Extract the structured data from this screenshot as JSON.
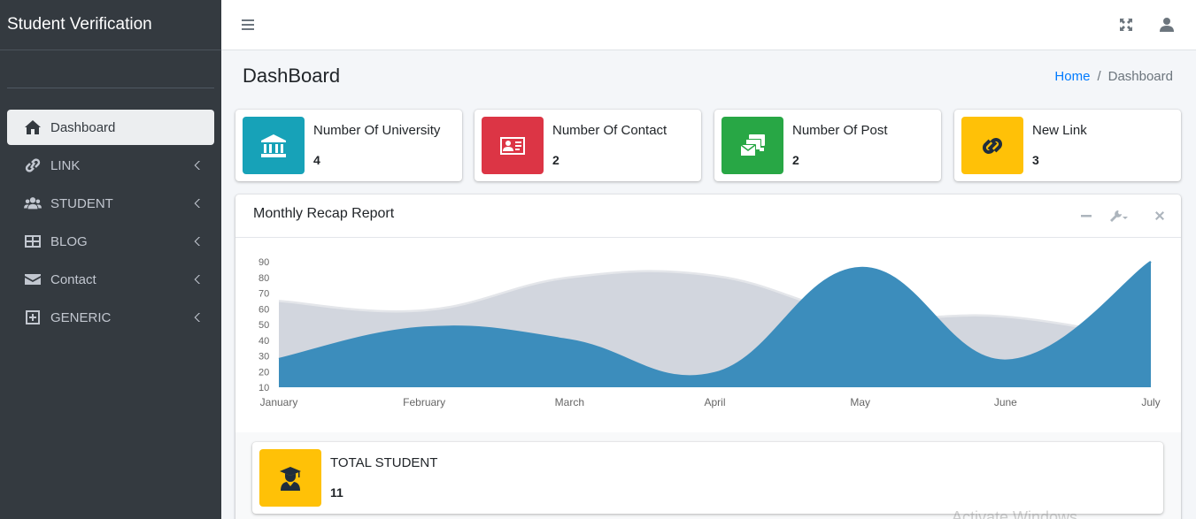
{
  "app": {
    "brand": "Student Verification"
  },
  "sidebar": {
    "items": [
      {
        "label": "Dashboard",
        "icon": "home-icon",
        "active": true
      },
      {
        "label": "LINK",
        "icon": "link-icon"
      },
      {
        "label": "STUDENT",
        "icon": "users-icon"
      },
      {
        "label": "BLOG",
        "icon": "th-large-icon"
      },
      {
        "label": "Contact",
        "icon": "envelope-icon"
      },
      {
        "label": "GENERIC",
        "icon": "plus-square-icon"
      }
    ]
  },
  "header": {
    "title": "DashBoard",
    "breadcrumb": {
      "home": "Home",
      "separator": "/",
      "current": "Dashboard"
    }
  },
  "stats": [
    {
      "label": "Number Of University",
      "value": "4",
      "color": "#17a2b8",
      "icon": "university-icon"
    },
    {
      "label": "Number Of Contact",
      "value": "2",
      "color": "#dc3545",
      "icon": "id-card-icon"
    },
    {
      "label": "Number Of Post",
      "value": "2",
      "color": "#28a745",
      "icon": "mail-bulk-icon"
    },
    {
      "label": "New Link",
      "value": "3",
      "color": "#ffc107",
      "icon": "link-icon"
    }
  ],
  "report": {
    "title": "Monthly Recap Report"
  },
  "total": {
    "label": "TOTAL STUDENT",
    "value": "11",
    "color": "#ffc107",
    "icon": "user-graduate-icon"
  },
  "watermark": "Activate Windows",
  "chart_data": {
    "type": "area",
    "categories": [
      "January",
      "February",
      "March",
      "April",
      "May",
      "June",
      "July"
    ],
    "series": [
      {
        "values": [
          65,
          59,
          80,
          81,
          56,
          55,
          40
        ],
        "color": "#d2d6de"
      },
      {
        "values": [
          28,
          48,
          40,
          19,
          86,
          27,
          90
        ],
        "color": "#3c8dbc"
      }
    ],
    "yticks": [
      10,
      20,
      30,
      40,
      50,
      60,
      70,
      80,
      90
    ],
    "ylim": [
      10,
      90
    ],
    "grid": false
  }
}
